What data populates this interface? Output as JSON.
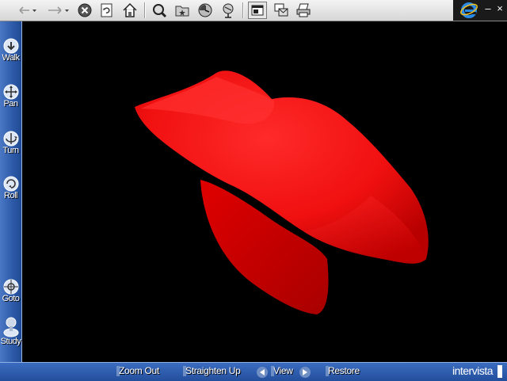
{
  "toolbar": {
    "buttons": [
      "back-icon",
      "forward-icon",
      "stop-icon",
      "refresh-icon",
      "home-icon",
      "search-icon",
      "favorites-icon",
      "history-icon",
      "channels-icon",
      "fullscreen-icon",
      "mail-icon",
      "print-icon"
    ],
    "window_controls": {
      "minimize": "–",
      "close": "×"
    }
  },
  "sidebar": {
    "items": [
      {
        "label": "Walk",
        "icon": "walk-icon"
      },
      {
        "label": "Pan",
        "icon": "pan-icon"
      },
      {
        "label": "Turn",
        "icon": "turn-icon"
      },
      {
        "label": "Roll",
        "icon": "roll-icon"
      },
      {
        "label": "Goto",
        "icon": "goto-icon"
      },
      {
        "label": "Study",
        "icon": "study-icon"
      }
    ]
  },
  "viewport": {
    "background": "#000000",
    "object_color": "#ff1010",
    "description_icon": "3d-red-shape"
  },
  "bottombar": {
    "zoom_out": "Zoom Out",
    "straighten_up": "Straighten Up",
    "view": "View",
    "restore": "Restore",
    "brand": "intervista"
  },
  "colors": {
    "accent": "#2d5aa8",
    "toolbar": "#e0e0e0",
    "object": "#ff1a1a"
  }
}
